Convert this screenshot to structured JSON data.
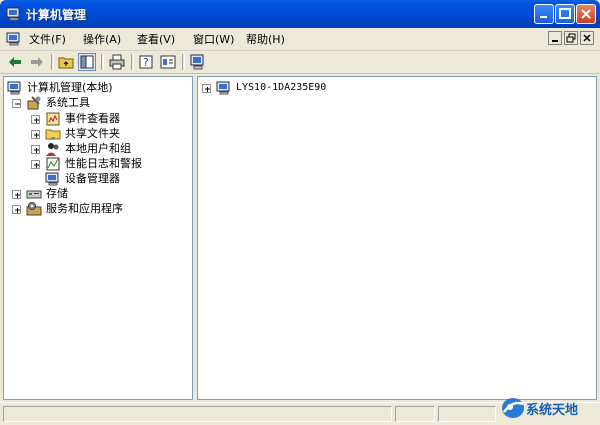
{
  "window": {
    "title": "计算机管理"
  },
  "menubar": {
    "items": [
      "文件(F)",
      "操作(A)",
      "查看(V)",
      "窗口(W)",
      "帮助(H)"
    ]
  },
  "tree": {
    "root": "计算机管理(本地)",
    "system_tools": "系统工具",
    "children": [
      "事件查看器",
      "共享文件夹",
      "本地用户和组",
      "性能日志和警报",
      "设备管理器"
    ],
    "storage": "存储",
    "services": "服务和应用程序"
  },
  "right": {
    "computer_name": "LYS10-1DA235E90"
  },
  "watermark": "系统天地",
  "colors": {
    "titlebar": "#0054e3",
    "pane_border": "#7f9db9",
    "watermark": "#1a5fb4"
  }
}
